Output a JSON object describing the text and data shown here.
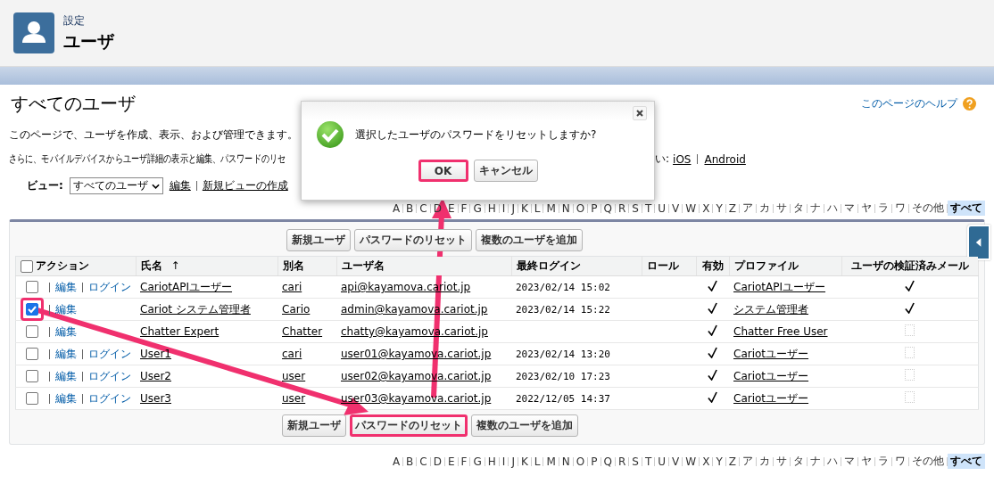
{
  "header": {
    "breadcrumb": "設定",
    "title": "ユーザ"
  },
  "page": {
    "title": "すべてのユーザ",
    "help_link": "このページのヘルプ",
    "description": "このページで、ユーザを作成、表示、および管理できます。",
    "mobile_note_start": "さらに、モバイルデバイスからユーザ詳細の表示と編集、パスワードのリセ",
    "mobile_note_end": "い:",
    "mobile_links": [
      "iOS",
      "Android"
    ]
  },
  "view": {
    "label": "ビュー:",
    "selected_view": "すべてのユーザ",
    "links": [
      "編集",
      "新規ビューの作成"
    ]
  },
  "alphabet_top": [
    {
      "label": "A",
      "selected": false
    },
    {
      "label": "B",
      "selected": false
    },
    {
      "label": "C",
      "selected": false
    },
    {
      "label": "D",
      "selected": false
    },
    {
      "label": "E",
      "selected": false
    },
    {
      "label": "F",
      "selected": false
    },
    {
      "label": "G",
      "selected": false
    },
    {
      "label": "H",
      "selected": false
    },
    {
      "label": "I",
      "selected": false
    },
    {
      "label": "J",
      "selected": false
    },
    {
      "label": "K",
      "selected": false
    },
    {
      "label": "L",
      "selected": false
    },
    {
      "label": "M",
      "selected": false
    },
    {
      "label": "N",
      "selected": false
    },
    {
      "label": "O",
      "selected": false
    },
    {
      "label": "P",
      "selected": false
    },
    {
      "label": "Q",
      "selected": false
    },
    {
      "label": "R",
      "selected": false
    },
    {
      "label": "S",
      "selected": false
    },
    {
      "label": "T",
      "selected": false
    },
    {
      "label": "U",
      "selected": false
    },
    {
      "label": "V",
      "selected": false
    },
    {
      "label": "W",
      "selected": false
    },
    {
      "label": "X",
      "selected": false
    },
    {
      "label": "Y",
      "selected": false
    },
    {
      "label": "Z",
      "selected": false
    },
    {
      "label": "ア",
      "selected": false
    },
    {
      "label": "カ",
      "selected": false
    },
    {
      "label": "サ",
      "selected": false
    },
    {
      "label": "タ",
      "selected": false
    },
    {
      "label": "ナ",
      "selected": false
    },
    {
      "label": "ハ",
      "selected": false
    },
    {
      "label": "マ",
      "selected": false
    },
    {
      "label": "ヤ",
      "selected": false
    },
    {
      "label": "ラ",
      "selected": false
    },
    {
      "label": "ワ",
      "selected": false
    },
    {
      "label": "その他",
      "selected": false
    },
    {
      "label": "すべて",
      "selected": true
    }
  ],
  "table": {
    "buttons_top": [
      {
        "label": "新規ユーザ",
        "highlighted": false
      },
      {
        "label": "パスワードのリセット",
        "highlighted": false
      },
      {
        "label": "複数のユーザを追加",
        "highlighted": false
      }
    ],
    "select_all_checked": false,
    "columns": [
      {
        "label": "アクション"
      },
      {
        "label": "氏名",
        "sort_mark": "↑"
      },
      {
        "label": "別名"
      },
      {
        "label": "ユーザ名"
      },
      {
        "label": "最終ログイン"
      },
      {
        "label": "ロール"
      },
      {
        "label": "有効"
      },
      {
        "label": "プロファイル"
      },
      {
        "label": "ユーザの検証済みメール"
      }
    ],
    "rows": [
      {
        "checked": false,
        "highlighted": false,
        "actions": [
          "編集",
          "ログイン"
        ],
        "name": "CariotAPIユーザー",
        "alias": "cari",
        "username": "api@kayamova.cariot.jp",
        "last_login": "2023/02/14 15:02",
        "active": true,
        "profile": "CariotAPIユーザー",
        "email_verified": true
      },
      {
        "checked": true,
        "highlighted": true,
        "actions": [
          "編集"
        ],
        "name": "Cariot システム管理者",
        "alias": "Cario",
        "username": "admin@kayamova.cariot.jp",
        "last_login": "2023/02/14 15:22",
        "active": true,
        "profile": "システム管理者",
        "email_verified": true
      },
      {
        "checked": false,
        "highlighted": false,
        "actions": [
          "編集"
        ],
        "name": "Chatter Expert",
        "alias": "Chatter",
        "username": "chatty@kayamova.cariot.jp",
        "active": true,
        "profile": "Chatter Free User",
        "email_verified": false
      },
      {
        "checked": false,
        "highlighted": false,
        "actions": [
          "編集",
          "ログイン"
        ],
        "name": "User1",
        "alias": "cari",
        "username": "user01@kayamova.cariot.jp",
        "last_login": "2023/02/14 13:20",
        "active": true,
        "profile": "Cariotユーザー",
        "email_verified": false
      },
      {
        "checked": false,
        "highlighted": false,
        "actions": [
          "編集",
          "ログイン"
        ],
        "name": "User2",
        "alias": "user",
        "username": "user02@kayamova.cariot.jp",
        "last_login": "2023/02/10 17:23",
        "active": true,
        "profile": "Cariotユーザー",
        "email_verified": false
      },
      {
        "checked": false,
        "highlighted": false,
        "actions": [
          "編集",
          "ログイン"
        ],
        "name": "User3",
        "alias": "user",
        "username": "user03@kayamova.cariot.jp",
        "last_login": "2022/12/05 14:37",
        "active": true,
        "profile": "Cariotユーザー",
        "email_verified": false
      }
    ],
    "buttons_bottom": [
      {
        "label": "新規ユーザ",
        "highlighted": false
      },
      {
        "label": "パスワードのリセット",
        "highlighted": true
      },
      {
        "label": "複数のユーザを追加",
        "highlighted": false
      }
    ]
  },
  "alphabet_bottom": [
    {
      "label": "A",
      "selected": false
    },
    {
      "label": "B",
      "selected": false
    },
    {
      "label": "C",
      "selected": false
    },
    {
      "label": "D",
      "selected": false
    },
    {
      "label": "E",
      "selected": false
    },
    {
      "label": "F",
      "selected": false
    },
    {
      "label": "G",
      "selected": false
    },
    {
      "label": "H",
      "selected": false
    },
    {
      "label": "I",
      "selected": false
    },
    {
      "label": "J",
      "selected": false
    },
    {
      "label": "K",
      "selected": false
    },
    {
      "label": "L",
      "selected": false
    },
    {
      "label": "M",
      "selected": false
    },
    {
      "label": "N",
      "selected": false
    },
    {
      "label": "O",
      "selected": false
    },
    {
      "label": "P",
      "selected": false
    },
    {
      "label": "Q",
      "selected": false
    },
    {
      "label": "R",
      "selected": false
    },
    {
      "label": "S",
      "selected": false
    },
    {
      "label": "T",
      "selected": false
    },
    {
      "label": "U",
      "selected": false
    },
    {
      "label": "V",
      "selected": false
    },
    {
      "label": "W",
      "selected": false
    },
    {
      "label": "X",
      "selected": false
    },
    {
      "label": "Y",
      "selected": false
    },
    {
      "label": "Z",
      "selected": false
    },
    {
      "label": "ア",
      "selected": false
    },
    {
      "label": "カ",
      "selected": false
    },
    {
      "label": "サ",
      "selected": false
    },
    {
      "label": "タ",
      "selected": false
    },
    {
      "label": "ナ",
      "selected": false
    },
    {
      "label": "ハ",
      "selected": false
    },
    {
      "label": "マ",
      "selected": false
    },
    {
      "label": "ヤ",
      "selected": false
    },
    {
      "label": "ラ",
      "selected": false
    },
    {
      "label": "ワ",
      "selected": false
    },
    {
      "label": "その他",
      "selected": false
    },
    {
      "label": "すべて",
      "selected": true
    }
  ],
  "dialog": {
    "message": "選択したユーザのパスワードをリセットしますか?",
    "buttons": [
      {
        "label": "OK",
        "highlighted": true
      },
      {
        "label": "キャンセル",
        "highlighted": false
      }
    ]
  }
}
